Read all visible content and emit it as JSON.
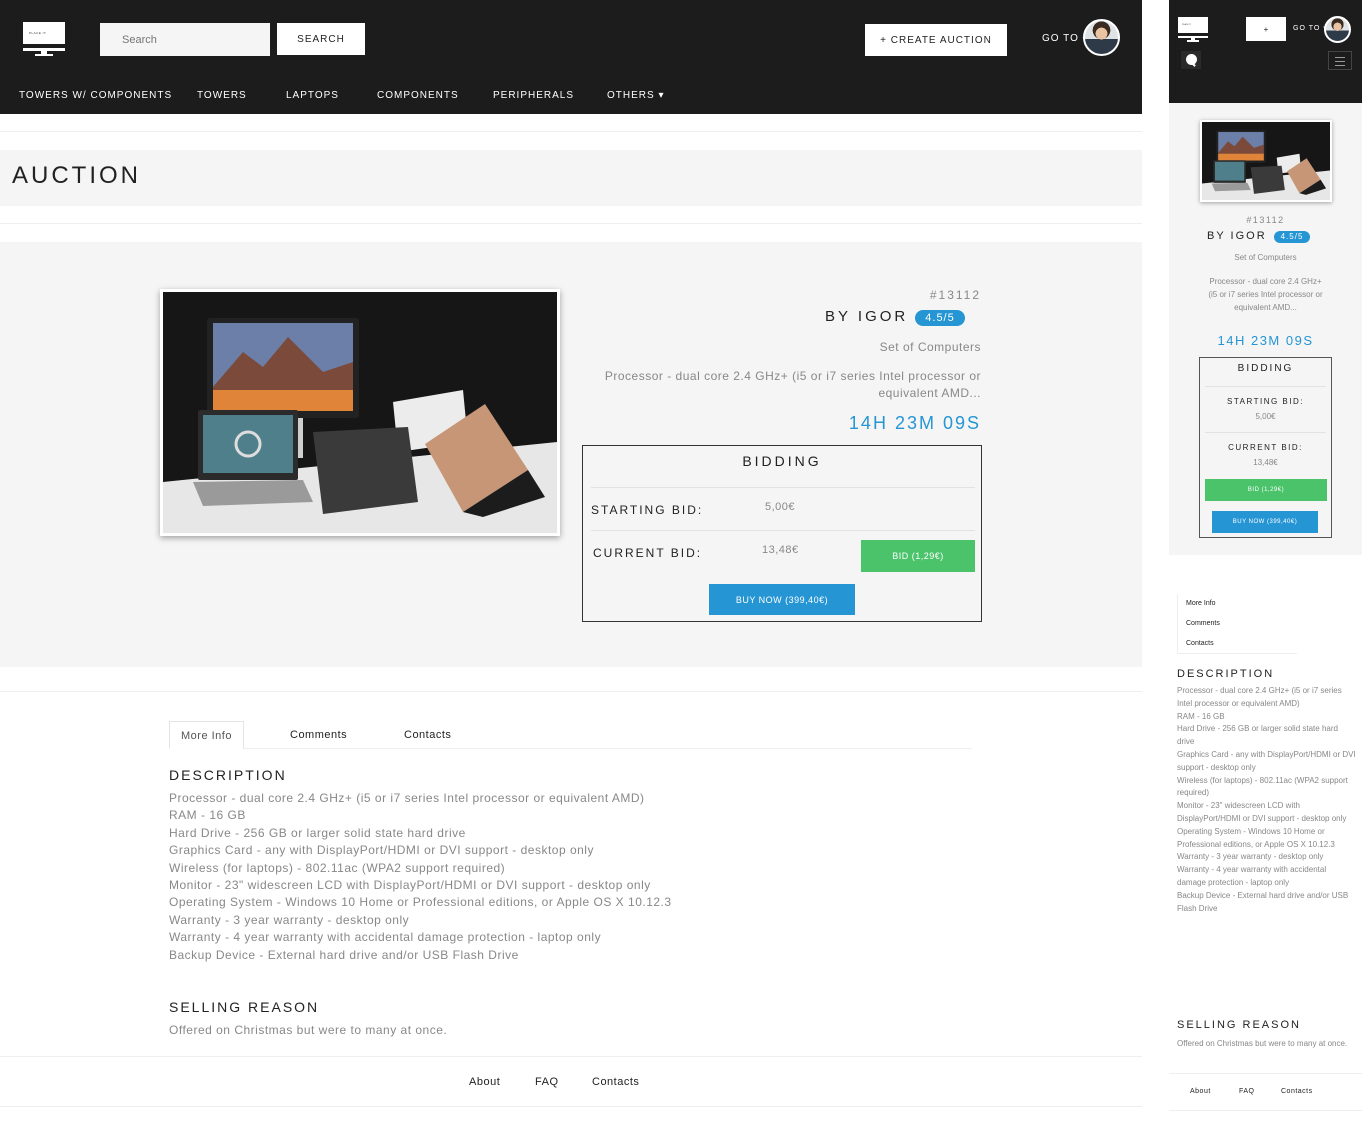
{
  "brand": {
    "logo_text": "PLACE IT"
  },
  "header": {
    "search_placeholder": "Search",
    "search_button": "SEARCH",
    "create_auction_button": "+ CREATE AUCTION",
    "goto_label": "GO TO",
    "goto_caret": "▾"
  },
  "nav": {
    "items": [
      {
        "label": "TOWERS W/ COMPONENTS"
      },
      {
        "label": "TOWERS"
      },
      {
        "label": "LAPTOPS"
      },
      {
        "label": "COMPONENTS"
      },
      {
        "label": "PERIPHERALS"
      },
      {
        "label": "OTHERS ▾"
      }
    ]
  },
  "page": {
    "title": "AUCTION"
  },
  "auction": {
    "id": "#13112",
    "seller": "BY IGOR",
    "rating": "4.5/5",
    "category": "Set of Computers",
    "short_description": "Processor - dual core 2.4 GHz+ (i5 or i7 series Intel processor or equivalent AMD...",
    "mobile_short_description": "Processor - dual core 2.4 GHz+ (i5 or i7 series Intel processor or equivalent AMD...",
    "time_left": "14H 23M 09S"
  },
  "bidding": {
    "title": "BIDDING",
    "starting_bid_label": "STARTING BID:",
    "starting_bid_value": "5,00€",
    "current_bid_label": "CURRENT BID:",
    "current_bid_value": "13,48€",
    "bid_button": "BID (1,29€)",
    "buy_now_button": "BUY NOW (399,40€)"
  },
  "tabs": {
    "items": [
      {
        "label": "More Info",
        "active": true
      },
      {
        "label": "Comments",
        "active": false
      },
      {
        "label": "Contacts",
        "active": false
      }
    ]
  },
  "description": {
    "title": "DESCRIPTION",
    "lines": [
      "Processor - dual core 2.4 GHz+ (i5 or i7 series Intel processor or equivalent AMD)",
      "RAM - 16 GB",
      "Hard Drive - 256 GB or larger solid state hard drive",
      "Graphics Card - any with DisplayPort/HDMI or DVI support - desktop only",
      "Wireless (for laptops) - 802.11ac (WPA2 support required)",
      "Monitor - 23\" widescreen LCD with DisplayPort/HDMI or DVI support - desktop only",
      "Operating System - Windows 10 Home or Professional editions, or Apple OS X 10.12.3",
      "Warranty - 3 year warranty - desktop only",
      "Warranty - 4 year warranty with accidental damage protection - laptop only",
      "Backup Device - External hard drive and/or USB Flash Drive"
    ]
  },
  "selling_reason": {
    "title": "SELLING REASON",
    "text": "Offered on Christmas but were to many at once."
  },
  "footer": {
    "links": [
      {
        "label": "About"
      },
      {
        "label": "FAQ"
      },
      {
        "label": "Contacts"
      }
    ]
  },
  "mobile": {
    "plus_button": "+",
    "goto_label": "GO TO ▾"
  },
  "colors": {
    "header_bg": "#1c1c1c",
    "band_bg": "#f5f5f5",
    "accent_blue": "#2595d4",
    "bid_green": "#4bc36b"
  },
  "icons": {
    "search": "search-icon",
    "menu": "hamburger-menu-icon",
    "avatar": "user-avatar"
  }
}
